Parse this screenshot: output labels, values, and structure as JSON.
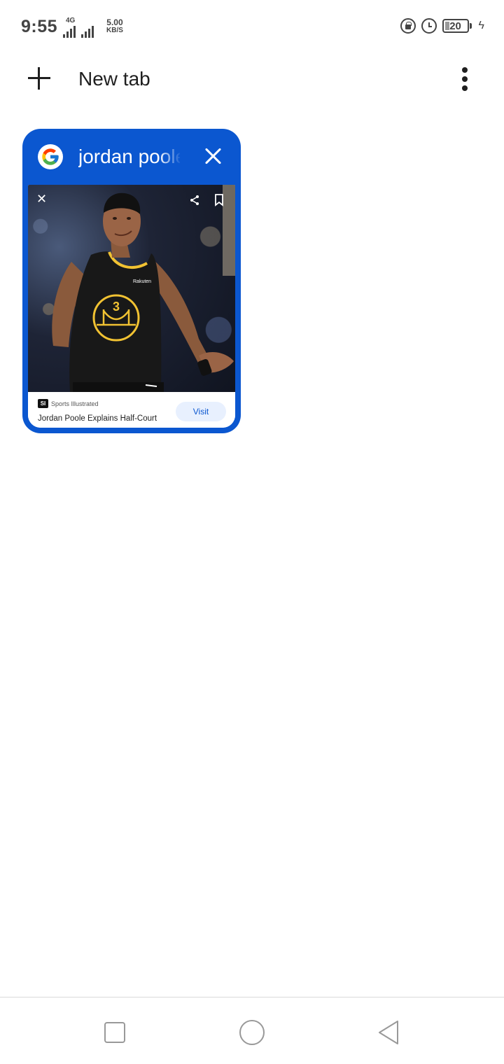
{
  "status_bar": {
    "time": "9:55",
    "network_type": "4G",
    "speed_value": "5.00",
    "speed_unit": "KB/S",
    "battery_level": "20",
    "icons": [
      "lock-rotation-icon",
      "alarm-icon",
      "battery-icon",
      "charging-icon",
      "signal-icon"
    ]
  },
  "toolbar": {
    "new_tab_label": "New tab",
    "icons": [
      "plus-icon",
      "more-vert-icon"
    ]
  },
  "tabs": [
    {
      "title": "jordan poole",
      "favicon": "google-icon",
      "selected": true,
      "preview": {
        "source": "Sports Illustrated",
        "source_logo_text": "SI",
        "headline": "Jordan Poole Explains Half-Court",
        "visit_label": "Visit",
        "jersey_number": "3",
        "jersey_sponsor": "Rakuten",
        "icons": [
          "close-icon",
          "share-icon",
          "bookmark-icon"
        ]
      }
    }
  ],
  "nav_bar": {
    "icons": [
      "recents-square-icon",
      "home-circle-icon",
      "back-triangle-icon"
    ]
  },
  "colors": {
    "accent": "#0b57d0",
    "background": "#ffffff",
    "visit_bg": "#e8f0fe",
    "jersey_gold": "#f1c232"
  }
}
